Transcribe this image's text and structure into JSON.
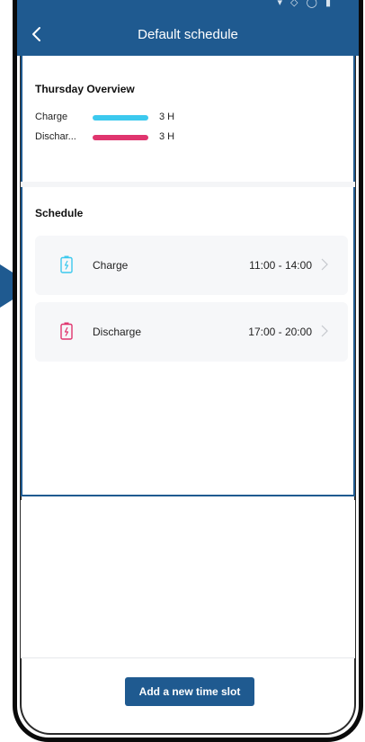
{
  "status_bar": {
    "icons": "▾ ◇ ◯ ▮"
  },
  "nav": {
    "title": "Default schedule",
    "back_icon": "chevron-left-icon"
  },
  "overview": {
    "title": "Thursday Overview",
    "rows": [
      {
        "label": "Charge",
        "value": "3 H",
        "color": "#3cc9ee"
      },
      {
        "label": "Dischar...",
        "value": "3 H",
        "color": "#e0356e"
      }
    ]
  },
  "schedule": {
    "title": "Schedule",
    "slots": [
      {
        "label": "Charge",
        "time": "11:00 - 14:00",
        "icon": "battery-charge-icon",
        "color": "#3cc9ee"
      },
      {
        "label": "Discharge",
        "time": "17:00 - 20:00",
        "icon": "battery-discharge-icon",
        "color": "#e0356e"
      }
    ]
  },
  "footer": {
    "add_button_label": "Add a new time slot"
  },
  "colors": {
    "primary": "#1f5a90",
    "pointer": "#1f5a90"
  }
}
